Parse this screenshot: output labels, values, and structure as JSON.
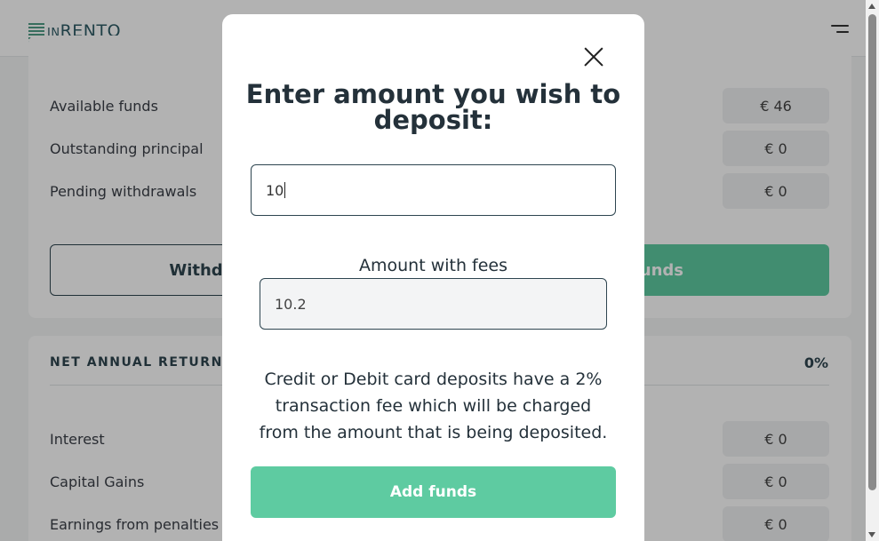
{
  "header": {
    "logo_text_small": "IN",
    "logo_text_large": "RENTO"
  },
  "funds": {
    "rows": [
      {
        "label": "Available funds",
        "value": "€ 46"
      },
      {
        "label": "Outstanding principal",
        "value": "€ 0"
      },
      {
        "label": "Pending withdrawals",
        "value": "€ 0"
      }
    ],
    "withdraw_label": "Withdraw funds",
    "add_label": "Add funds"
  },
  "returns": {
    "title": "NET ANNUAL RETURNS:",
    "value": "0%",
    "rows": [
      {
        "label": "Interest",
        "value": "€ 0"
      },
      {
        "label": "Capital Gains",
        "value": "€ 0"
      },
      {
        "label": "Earnings from penalties",
        "value": "€ 0"
      }
    ]
  },
  "modal": {
    "title": "Enter amount you wish to deposit:",
    "amount_value": "10",
    "fees_label": "Amount with fees",
    "fees_value": "10.2",
    "fee_note": "Credit or Debit card deposits have a 2% transaction fee which will be charged from the amount that is being deposited.",
    "add_button": "Add funds"
  },
  "colors": {
    "accent": "#5ecba1",
    "dark": "#2e4550"
  },
  "icons": {
    "menu": "menu-icon",
    "close": "close-icon"
  }
}
